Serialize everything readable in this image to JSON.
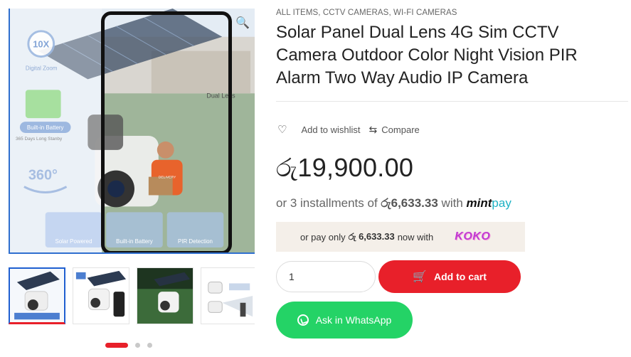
{
  "breadcrumbs": [
    "ALL ITEMS",
    "CCTV CAMERAS",
    "WI-FI CAMERAS"
  ],
  "product": {
    "title": "Solar Panel Dual Lens 4G Sim CCTV Camera Outdoor Color Night Vision PIR Alarm Two Way Audio IP Camera",
    "price": "රු19,900.00"
  },
  "actions": {
    "wishlist_label": "Add to wishlist",
    "compare_label": "Compare"
  },
  "installments": {
    "prefix": "or 3 installments of",
    "amount": "රු6,633.33",
    "with": "with",
    "brand_main": "mint",
    "brand_pay": "pay"
  },
  "koko": {
    "prefix": "or pay only",
    "amount": "රු 6,633.33",
    "suffix": "now with",
    "brand": "KOKO"
  },
  "cart": {
    "quantity": "1",
    "add_label": "Add to cart"
  },
  "whatsapp": {
    "label": "Ask in WhatsApp"
  },
  "image_labels": {
    "zoom": "10X",
    "digital": "Digital Zoom",
    "battery": "Built-in Battery",
    "standby": "365 Days Long Stanby",
    "rotation": "360°",
    "dual": "Dual Lens",
    "solar": "Solar Powered",
    "battery_bottom": "Built-in Battery",
    "pir": "PIR Detection",
    "delivery": "DELIVERY"
  },
  "gallery": {
    "thumbnail_count": 4,
    "active_dot": 0,
    "dot_count": 3
  },
  "colors": {
    "accent_red": "#e8202a",
    "whatsapp_green": "#24d366",
    "koko_bg": "#f4efe9",
    "gallery_blue": "#1f5fd0"
  }
}
